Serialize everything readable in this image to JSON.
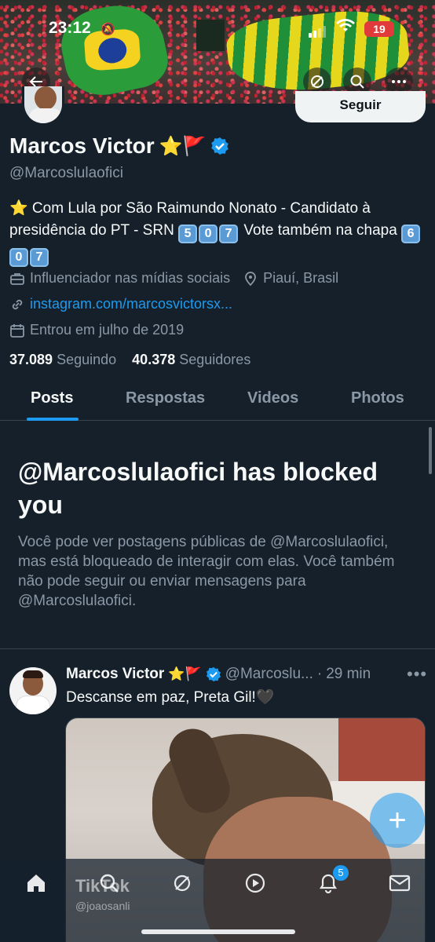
{
  "status": {
    "time": "23:12",
    "battery": "19"
  },
  "profile": {
    "name": "Marcos Victor",
    "name_emoji": "⭐🚩",
    "handle": "@Marcoslulaofici",
    "follow_label": "Seguir",
    "bio_prefix": "⭐ Com Lula por São Raimundo Nonato - Candidato à presidência do PT - SRN",
    "bio_number_1": [
      "5",
      "0",
      "7"
    ],
    "bio_middle": "Vote também na chapa",
    "bio_number_2": [
      "6",
      "0",
      "7"
    ],
    "category": "Influenciador nas mídias sociais",
    "location": "Piauí, Brasil",
    "website": "instagram.com/marcosvictorsx...",
    "joined": "Entrou em julho de 2019",
    "following_count": "37.089",
    "following_label": "Seguindo",
    "followers_count": "40.378",
    "followers_label": "Seguidores"
  },
  "tabs": [
    "Posts",
    "Respostas",
    "Videos",
    "Photos"
  ],
  "blocked": {
    "title": "@Marcoslulaofici has blocked you",
    "text": "Você pode ver postagens públicas de @Marcoslulaofici, mas está bloqueado de interagir com elas. Você também não pode seguir ou enviar mensagens para @Marcoslulaofici."
  },
  "post": {
    "name": "Marcos Victor",
    "name_emoji": "⭐🚩",
    "handle": "@Marcoslu...",
    "separator": "·",
    "time": "29 min",
    "text": "Descanse em paz, Preta Gil!🖤",
    "more": "•••"
  },
  "media_overlay": {
    "brand": "TikTok",
    "user": "@joaosanli"
  },
  "nav": {
    "notifications_badge": "5"
  },
  "colors": {
    "background": "#15202b",
    "accent": "#1d9bf0",
    "muted": "#8b98a5"
  }
}
